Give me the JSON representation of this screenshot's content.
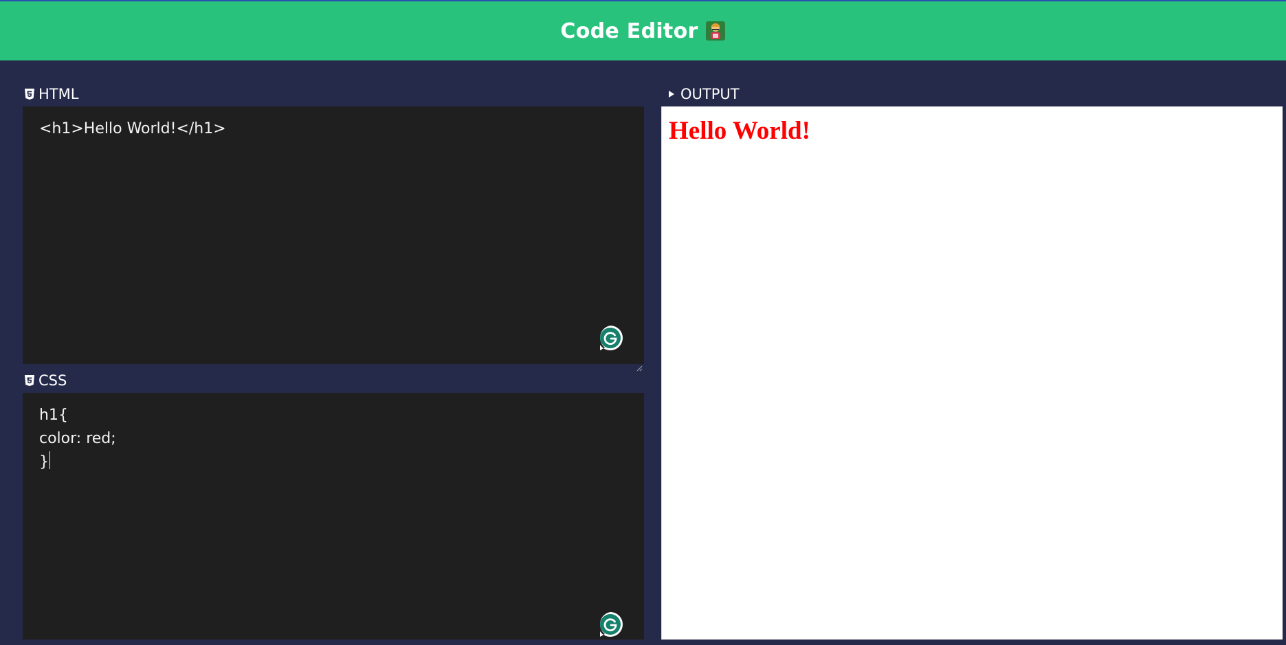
{
  "header": {
    "title": "Code Editor",
    "mascot_icon": "developer-mascot-icon",
    "background": "#29c27d"
  },
  "html_panel": {
    "label": "HTML",
    "icon": "html5-icon",
    "code_lines": [
      "<h1>Hello World!</h1>"
    ]
  },
  "css_panel": {
    "label": "CSS",
    "icon": "css3-icon",
    "code_lines": [
      "h1{",
      "color: red;",
      "}"
    ]
  },
  "output_panel": {
    "label": "OUTPUT",
    "icon": "play-triangle-icon",
    "rendered_heading": "Hello World!",
    "rendered_color": "#ff0000"
  },
  "colors": {
    "page_bg": "#262a4a",
    "editor_bg": "#1f1f1f",
    "grammarly": "#15c39a"
  }
}
